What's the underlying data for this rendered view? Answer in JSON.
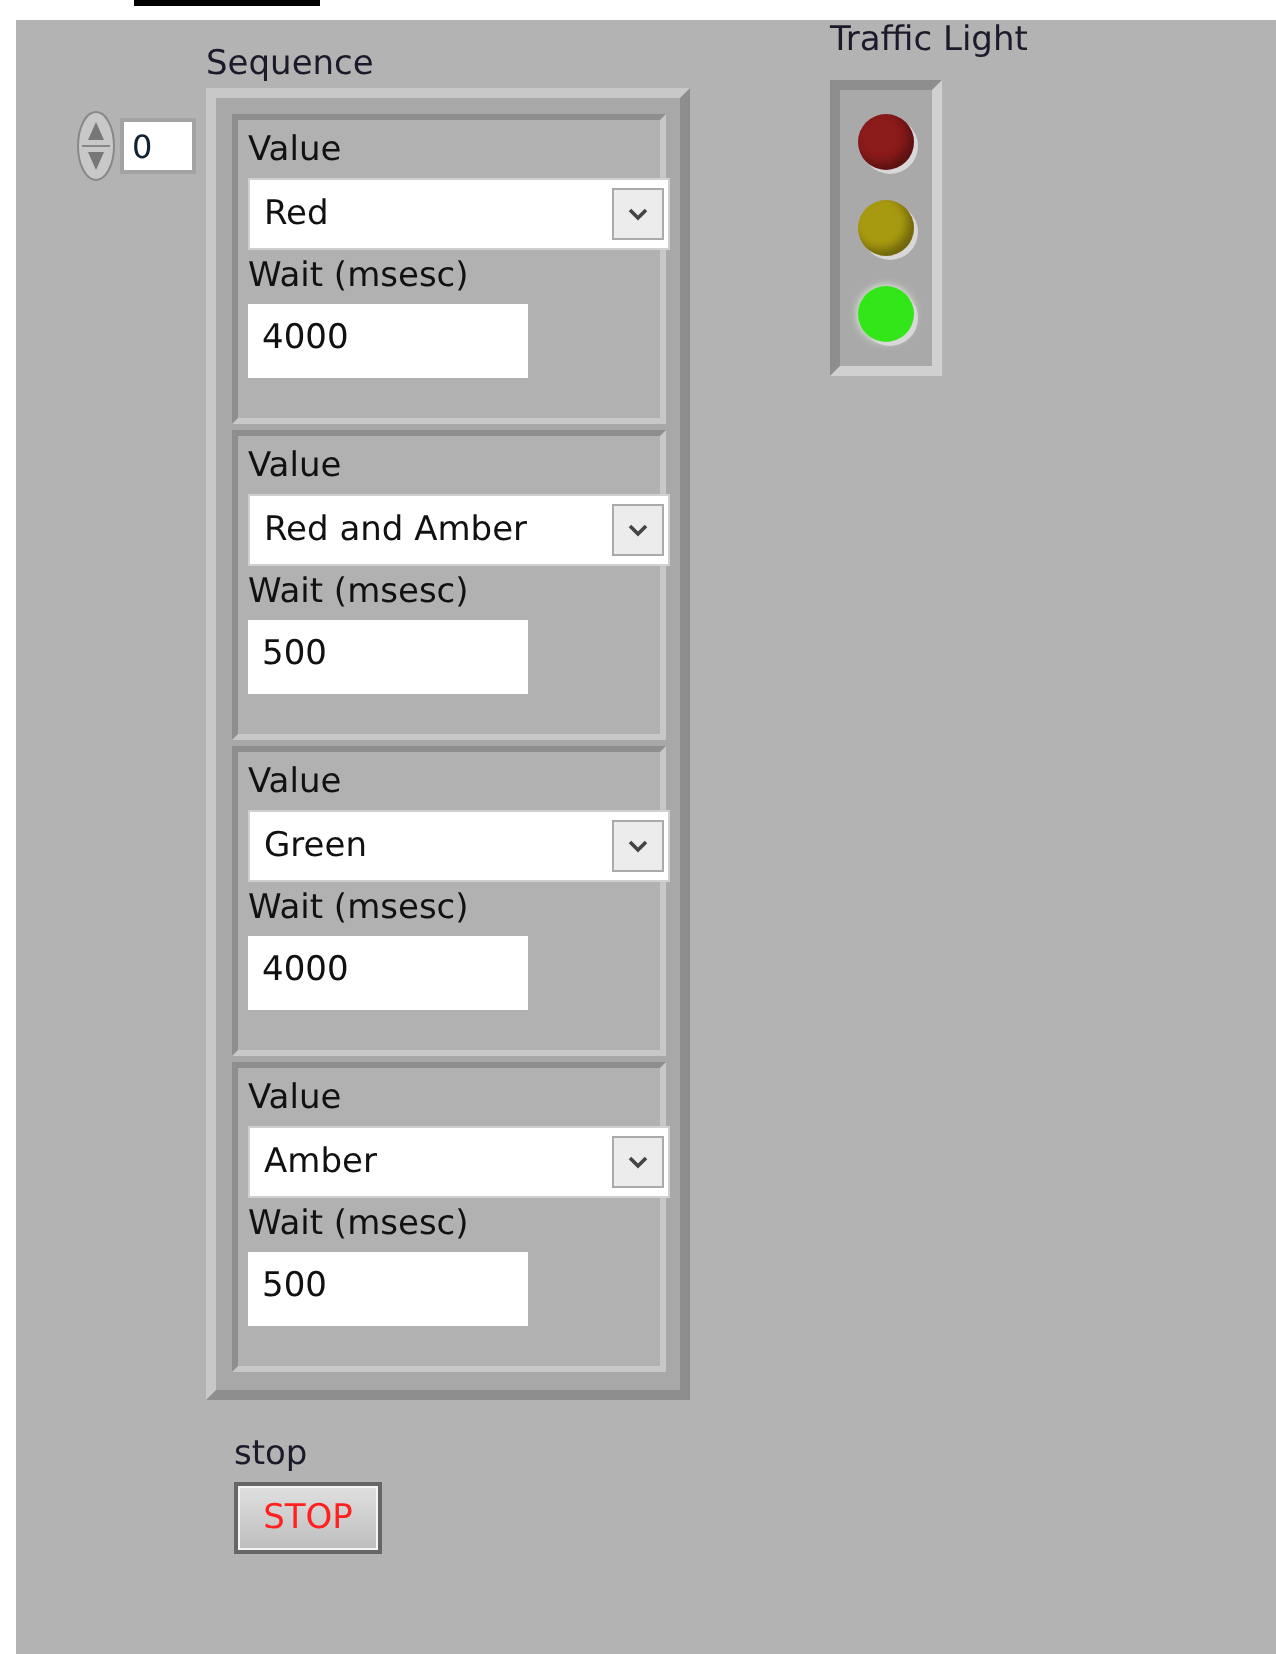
{
  "index": {
    "value": "0"
  },
  "sequence": {
    "label": "Sequence",
    "elements": [
      {
        "value_label": "Value",
        "value": "Red",
        "wait_label": "Wait (msesc)",
        "wait": "4000"
      },
      {
        "value_label": "Value",
        "value": "Red and Amber",
        "wait_label": "Wait (msesc)",
        "wait": "500"
      },
      {
        "value_label": "Value",
        "value": "Green",
        "wait_label": "Wait (msesc)",
        "wait": "4000"
      },
      {
        "value_label": "Value",
        "value": "Amber",
        "wait_label": "Wait (msesc)",
        "wait": "500"
      }
    ]
  },
  "traffic_light": {
    "label": "Traffic Light",
    "lights": [
      {
        "color": "#8b1a1a",
        "on": false
      },
      {
        "color": "#a89a10",
        "on": false
      },
      {
        "color": "#33e61a",
        "on": true
      }
    ]
  },
  "stop": {
    "label": "stop",
    "button": "STOP"
  }
}
